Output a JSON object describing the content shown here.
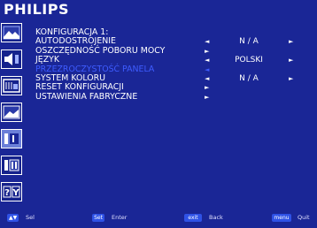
{
  "header": {
    "brand": "PHILIPS"
  },
  "sidebar": {
    "items": [
      {
        "icon": "picture-icon"
      },
      {
        "icon": "audio-icon"
      },
      {
        "icon": "pip-icon"
      },
      {
        "icon": "image-settings-icon"
      },
      {
        "icon": "configuration-1-icon",
        "active": true
      },
      {
        "icon": "configuration-2-icon"
      },
      {
        "icon": "advanced-option-icon"
      }
    ]
  },
  "menu": {
    "title": "KONFIGURACJA 1:",
    "rows": [
      {
        "label": "AUTODOSTROJENIE",
        "left_arrow": "◄",
        "value": "N / A",
        "right_arrow": "►"
      },
      {
        "label": "OSZCZĘDNOŚĆ POBORU MOCY",
        "left_arrow": "",
        "value": "",
        "right_arrow": "►",
        "right_arrow_left": true
      },
      {
        "label": "JĘZYK",
        "left_arrow": "◄",
        "value": "POLSKI",
        "right_arrow": "►"
      },
      {
        "label": "PRZEZROCZYSTOŚĆ PANELA",
        "left_arrow": "◄",
        "value": "",
        "right_arrow": "",
        "selected": true
      },
      {
        "label": "SYSTEM KOLORU",
        "left_arrow": "◄",
        "value": "N / A",
        "right_arrow": "►"
      },
      {
        "label": "RESET KONFIGURACJI",
        "left_arrow": "►",
        "value": "",
        "right_arrow": ""
      },
      {
        "label": "USTAWIENIA FABRYCZNE",
        "left_arrow": "►",
        "value": "",
        "right_arrow": ""
      }
    ]
  },
  "footer": {
    "sel_button": "▲▼",
    "sel_label": "Sel",
    "enter_button": "Set",
    "enter_label": "Enter",
    "exit_button": "exit",
    "exit_label": "Back",
    "quit_button": "menu",
    "quit_label": "Quit"
  },
  "colors": {
    "background": "#1a2696",
    "selected": "#3e5cff",
    "button": "#2f52e6"
  }
}
